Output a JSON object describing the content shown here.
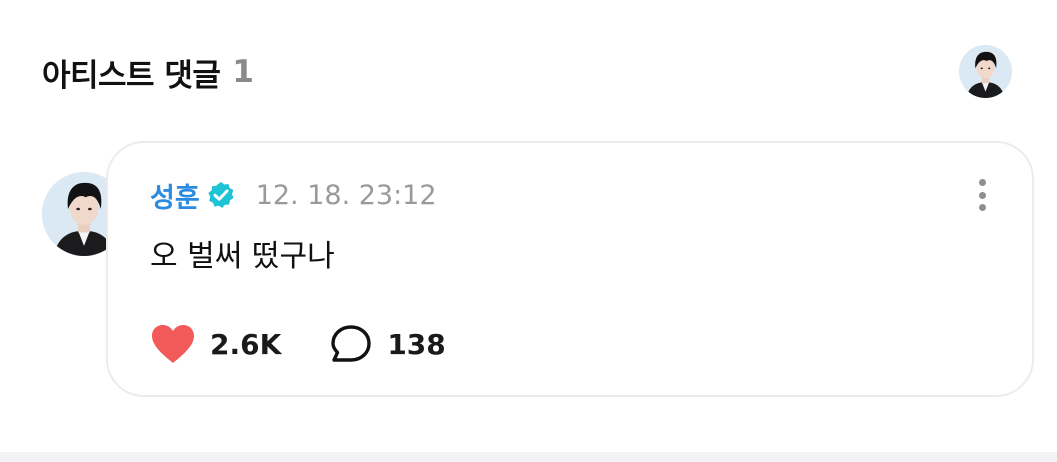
{
  "header": {
    "title": "아티스트 댓글",
    "count": "1"
  },
  "comment": {
    "author": "성훈",
    "timestamp": "12. 18. 23:12",
    "text": "오 벌써 떴구나",
    "likes": "2.6K",
    "replies": "138"
  },
  "icons": {
    "verified": "verified-badge-icon",
    "more": "more-vertical-icon",
    "like": "heart-icon",
    "reply": "speech-bubble-icon"
  },
  "colors": {
    "author": "#2b8be0",
    "verified": "#1ec3d6",
    "heart": "#f25a5a",
    "count": "#8a8a8a",
    "card_border": "#ececec"
  }
}
